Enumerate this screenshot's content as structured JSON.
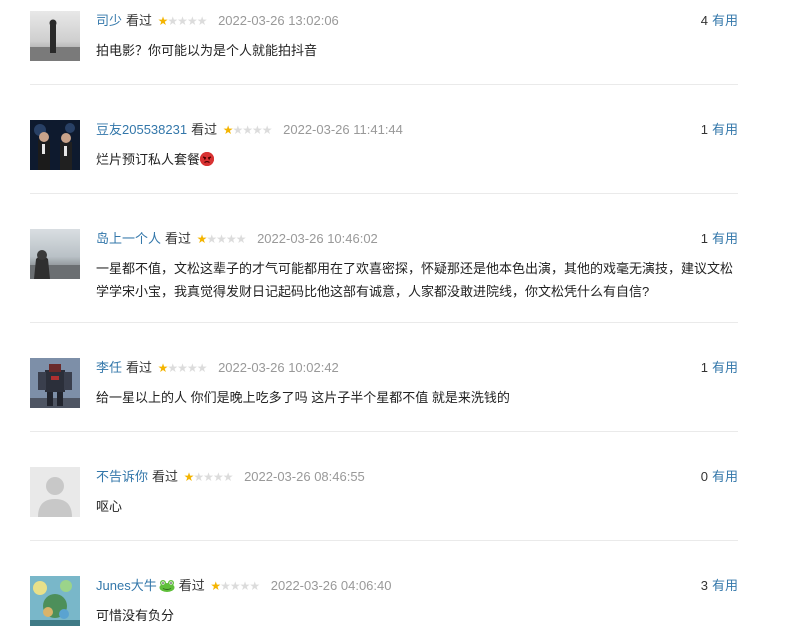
{
  "labels": {
    "watched": "看过",
    "useful": "有用"
  },
  "colors": {
    "link": "#3377aa",
    "star": "#f4b400",
    "star_empty": "#dcdcdc",
    "time": "#999999"
  },
  "comments": [
    {
      "user": "司少",
      "rating": 1,
      "time": "2022-03-26 13:02:06",
      "votes": "4",
      "text": "拍电影？你可能以为是个人就能拍抖音"
    },
    {
      "user": "豆友205538231",
      "rating": 1,
      "time": "2022-03-26 11:41:44",
      "votes": "1",
      "text": "烂片预订私人套餐",
      "emoji": "angry-face-icon"
    },
    {
      "user": "岛上一个人",
      "rating": 1,
      "time": "2022-03-26 10:46:02",
      "votes": "1",
      "text": "一星都不值，文松这辈子的才气可能都用在了欢喜密探，怀疑那还是他本色出演，其他的戏毫无演技，建议文松学学宋小宝，我真觉得发财日记起码比他这部有诚意，人家都没敢进院线，你文松凭什么有自信?"
    },
    {
      "user": "李任",
      "rating": 1,
      "time": "2022-03-26 10:02:42",
      "votes": "1",
      "text": "给一星以上的人 你们是晚上吃多了吗 这片子半个星都不值 就是来洗钱的"
    },
    {
      "user": "不告诉你",
      "rating": 1,
      "time": "2022-03-26 08:46:55",
      "votes": "0",
      "text": "呕心"
    },
    {
      "user": "Junes大牛",
      "rating": 1,
      "time": "2022-03-26 04:06:40",
      "votes": "3",
      "text": "可惜没有负分",
      "name_emoji": "frog-icon"
    }
  ]
}
